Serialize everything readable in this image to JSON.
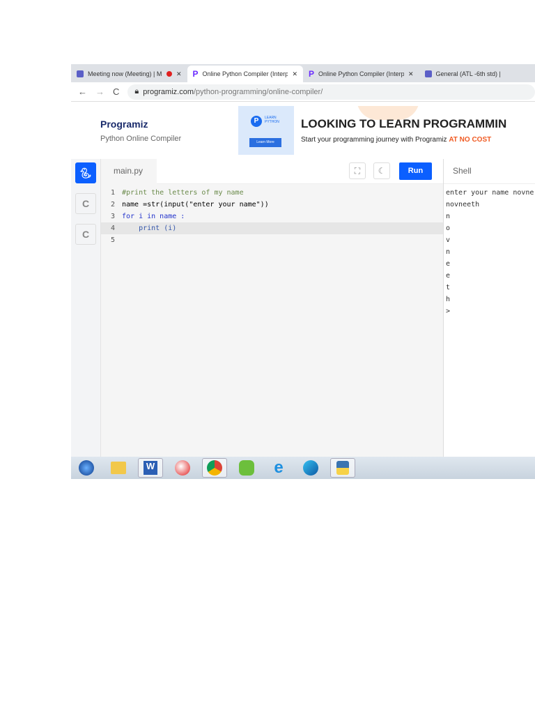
{
  "browser": {
    "tabs": [
      {
        "title": "Meeting now (Meeting) | Mi",
        "icon": "teams-icon",
        "recording": true
      },
      {
        "title": "Online Python Compiler (Interpre",
        "icon": "programiz-icon",
        "active": true
      },
      {
        "title": "Online Python Compiler (Interpre",
        "icon": "programiz-icon"
      },
      {
        "title": "General (ATL -6th std) |",
        "icon": "teams-icon"
      }
    ],
    "url_domain": "programiz.com",
    "url_path": "/python-programming/online-compiler/"
  },
  "header": {
    "logo": "Programiz",
    "subtitle": "Python Online Compiler"
  },
  "ad": {
    "badge": "LEARN PYTHON",
    "button": "Learn More",
    "headline": "LOOKING TO LEARN PROGRAMMIN",
    "text": "Start your programming journey with Programiz ",
    "highlight": "AT NO COST"
  },
  "editor": {
    "filename": "main.py",
    "run_label": "Run",
    "lines": [
      {
        "n": "1",
        "code": "#print the letters of my name"
      },
      {
        "n": "2",
        "code": "name =str(input(\"enter your name\"))"
      },
      {
        "n": "3",
        "code": "for i in name :"
      },
      {
        "n": "4",
        "code": "    print (i)"
      },
      {
        "n": "5",
        "code": ""
      }
    ]
  },
  "shell": {
    "title": "Shell",
    "output": [
      "enter your name novne",
      "novneeth",
      "n",
      "o",
      "v",
      "n",
      "e",
      "e",
      "t",
      "h",
      ">"
    ]
  },
  "taskbar": [
    "start",
    "explorer",
    "word",
    "camera",
    "chrome",
    "messenger",
    "ie",
    "edge",
    "python"
  ]
}
